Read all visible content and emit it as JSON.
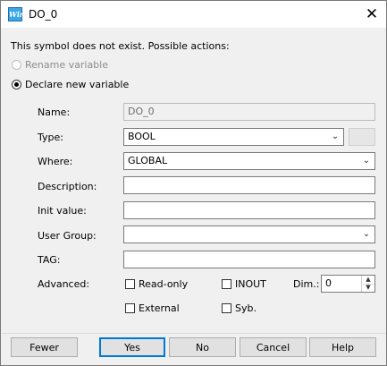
{
  "window": {
    "title": "DO_0",
    "app_icon": "Win",
    "close_glyph": "✕"
  },
  "message": "This symbol does not exist. Possible actions:",
  "options": {
    "rename": "Rename variable",
    "declare": "Declare new variable",
    "selected": "declare"
  },
  "form": {
    "name_label": "Name:",
    "name_value": "DO_0",
    "type_label": "Type:",
    "type_value": "BOOL",
    "where_label": "Where:",
    "where_value": "GLOBAL",
    "description_label": "Description:",
    "description_value": "",
    "init_label": "Init value:",
    "init_value": "",
    "group_label": "User Group:",
    "group_value": "",
    "tag_label": "TAG:",
    "tag_value": "",
    "advanced_label": "Advanced:",
    "readonly_label": "Read-only",
    "inout_label": "INOUT",
    "dim_label": "Dim.:",
    "dim_value": "0",
    "external_label": "External",
    "syb_label": "Syb."
  },
  "buttons": {
    "fewer": "Fewer",
    "yes": "Yes",
    "no": "No",
    "cancel": "Cancel",
    "help": "Help"
  },
  "colors": {
    "default_button_border": "#0078d7",
    "dialog_bg": "#f0f0f0"
  }
}
